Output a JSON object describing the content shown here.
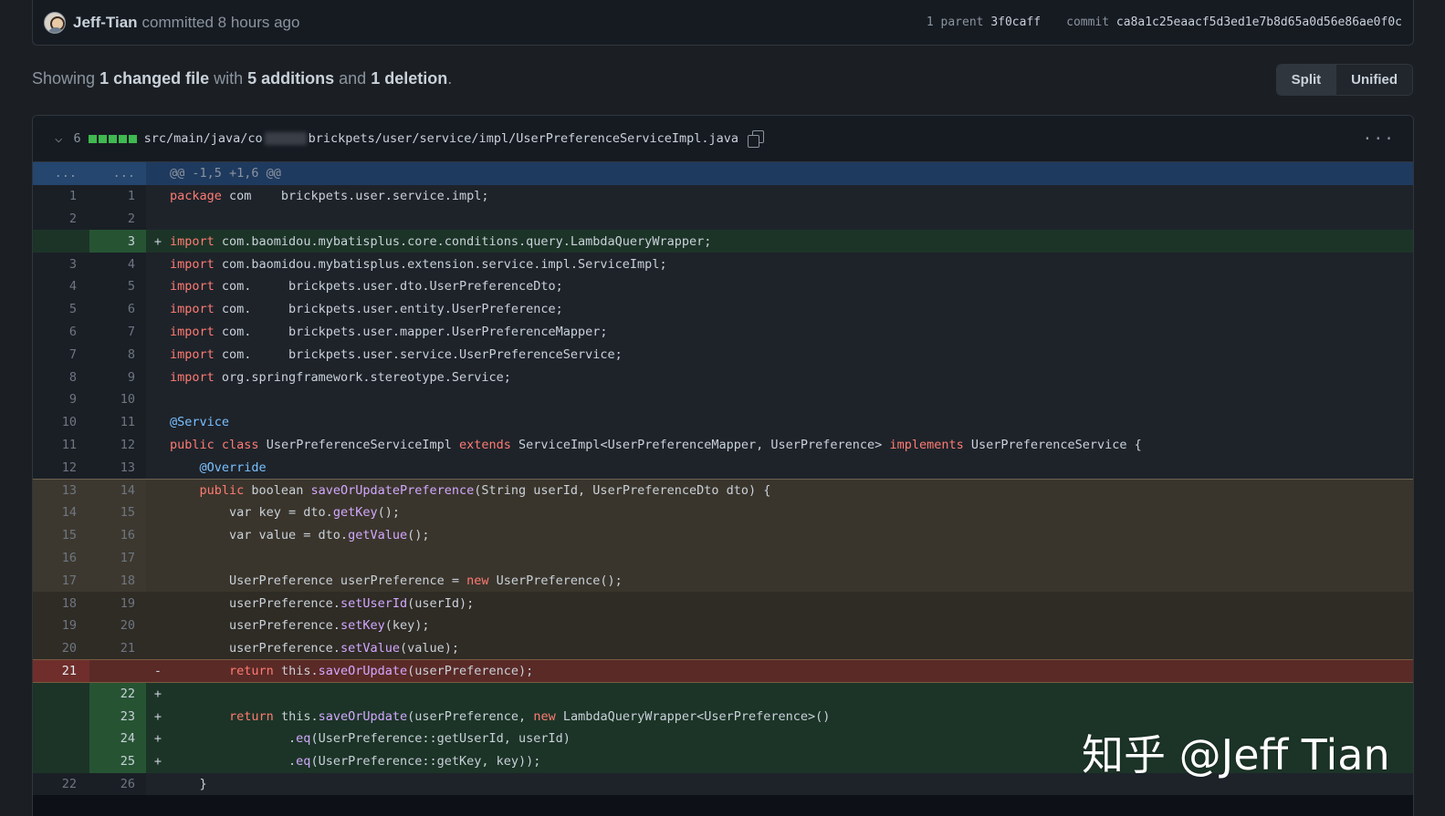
{
  "commit": {
    "author": "Jeff-Tian",
    "action": "committed 8 hours ago",
    "parent_label": "1 parent",
    "parent_sha": "3f0caff",
    "commit_label": "commit",
    "commit_sha": "ca8a1c25eaacf5d3ed1e7b8d65a0d56e86ae0f0c"
  },
  "summary": {
    "prefix": "Showing ",
    "files": "1 changed file",
    "with": " with ",
    "additions": "5 additions",
    "and": " and ",
    "deletions": "1 deletion",
    "suffix": "."
  },
  "view_toggle": {
    "split": "Split",
    "unified": "Unified"
  },
  "file": {
    "change_count": "6",
    "path_prefix": "src/main/java/co",
    "path_suffix": "brickpets/user/service/impl/UserPreferenceServiceImpl.java",
    "kebab": "···",
    "diffstat": [
      "add",
      "add",
      "add",
      "add",
      "add"
    ]
  },
  "diff_lines": [
    {
      "type": "hunk",
      "old": "...",
      "new": "...",
      "sign": "",
      "code": "@@ -1,5 +1,6 @@"
    },
    {
      "type": "ctx",
      "old": "1",
      "new": "1",
      "sign": "",
      "code": "package com    brickpets.user.service.impl;"
    },
    {
      "type": "ctx",
      "old": "2",
      "new": "2",
      "sign": "",
      "code": ""
    },
    {
      "type": "add",
      "old": "",
      "new": "3",
      "sign": "+",
      "code": "import com.baomidou.mybatisplus.core.conditions.query.LambdaQueryWrapper;"
    },
    {
      "type": "ctx",
      "old": "3",
      "new": "4",
      "sign": "",
      "code": "import com.baomidou.mybatisplus.extension.service.impl.ServiceImpl;"
    },
    {
      "type": "ctx",
      "old": "4",
      "new": "5",
      "sign": "",
      "code": "import com.     brickpets.user.dto.UserPreferenceDto;"
    },
    {
      "type": "ctx",
      "old": "5",
      "new": "6",
      "sign": "",
      "code": "import com.     brickpets.user.entity.UserPreference;"
    },
    {
      "type": "ctx",
      "old": "6",
      "new": "7",
      "sign": "",
      "code": "import com.     brickpets.user.mapper.UserPreferenceMapper;"
    },
    {
      "type": "ctx",
      "old": "7",
      "new": "8",
      "sign": "",
      "code": "import com.     brickpets.user.service.UserPreferenceService;"
    },
    {
      "type": "ctx",
      "old": "8",
      "new": "9",
      "sign": "",
      "code": "import org.springframework.stereotype.Service;"
    },
    {
      "type": "ctx",
      "old": "9",
      "new": "10",
      "sign": "",
      "code": ""
    },
    {
      "type": "ctx",
      "old": "10",
      "new": "11",
      "sign": "",
      "code": "@Service"
    },
    {
      "type": "ctx",
      "old": "11",
      "new": "12",
      "sign": "",
      "code": "public class UserPreferenceServiceImpl extends ServiceImpl<UserPreferenceMapper, UserPreference> implements UserPreferenceService {"
    },
    {
      "type": "ctx",
      "old": "12",
      "new": "13",
      "sign": "",
      "code": "    @Override"
    },
    {
      "type": "sel",
      "old": "13",
      "new": "14",
      "sign": "",
      "code": "    public boolean saveOrUpdatePreference(String userId, UserPreferenceDto dto) {"
    },
    {
      "type": "sel",
      "old": "14",
      "new": "15",
      "sign": "",
      "code": "        var key = dto.getKey();"
    },
    {
      "type": "sel",
      "old": "15",
      "new": "16",
      "sign": "",
      "code": "        var value = dto.getValue();"
    },
    {
      "type": "sel",
      "old": "16",
      "new": "17",
      "sign": "",
      "code": ""
    },
    {
      "type": "sel",
      "old": "17",
      "new": "18",
      "sign": "",
      "code": "        UserPreference userPreference = new UserPreference();"
    },
    {
      "type": "sel-dark",
      "old": "18",
      "new": "19",
      "sign": "",
      "code": "        userPreference.setUserId(userId);"
    },
    {
      "type": "sel-dark",
      "old": "19",
      "new": "20",
      "sign": "",
      "code": "        userPreference.setKey(key);"
    },
    {
      "type": "sel-dark",
      "old": "20",
      "new": "21",
      "sign": "",
      "code": "        userPreference.setValue(value);"
    },
    {
      "type": "del",
      "old": "21",
      "new": "",
      "sign": "-",
      "code": "        return this.saveOrUpdate(userPreference);"
    },
    {
      "type": "add",
      "old": "",
      "new": "22",
      "sign": "+",
      "code": ""
    },
    {
      "type": "add",
      "old": "",
      "new": "23",
      "sign": "+",
      "code": "        return this.saveOrUpdate(userPreference, new LambdaQueryWrapper<UserPreference>()"
    },
    {
      "type": "add",
      "old": "",
      "new": "24",
      "sign": "+",
      "code": "                .eq(UserPreference::getUserId, userId)"
    },
    {
      "type": "add",
      "old": "",
      "new": "25",
      "sign": "+",
      "code": "                .eq(UserPreference::getKey, key));"
    },
    {
      "type": "ctx",
      "old": "22",
      "new": "26",
      "sign": "",
      "code": "    }"
    }
  ],
  "watermark": "知乎 @Jeff Tian",
  "colors": {
    "addition": "#3fb950",
    "deletion": "#f85149",
    "keyword": "#ff7b72",
    "function": "#d2a8ff",
    "annotation": "#79c0ff"
  }
}
